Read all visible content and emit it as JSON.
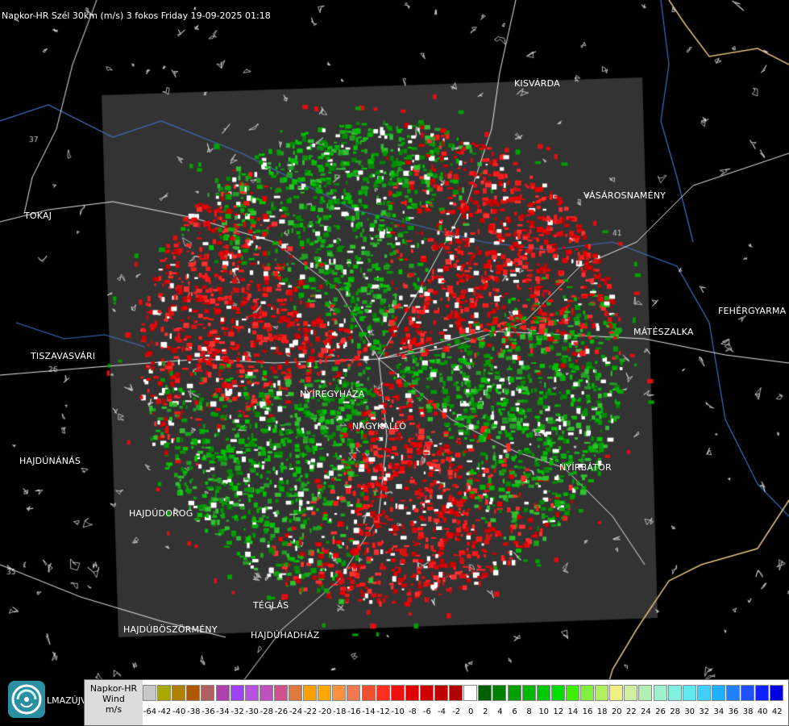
{
  "header": {
    "title": "Napkor-HR Szél 30km (m/s) 3 fokos Friday 19-09-2025 01:18"
  },
  "cities": [
    {
      "name": "KISVÁRDA"
    },
    {
      "name": "TOKAJ"
    },
    {
      "name": "VÁSÁROSNAMÉNY"
    },
    {
      "name": "FEHÉRGYARMA"
    },
    {
      "name": "MÁTÉSZALKA"
    },
    {
      "name": "TISZAVASVÁRI"
    },
    {
      "name": "NYÍREGYHÁZA"
    },
    {
      "name": "NAGYKALLÓ"
    },
    {
      "name": "HAJDÚNÁNÁS"
    },
    {
      "name": "NYÍRBÁTOR"
    },
    {
      "name": "HAJDÚDOROG"
    },
    {
      "name": "TÉGLÁS"
    },
    {
      "name": "HAJDÚBÖSZÖRMÉNY"
    },
    {
      "name": "HAJDÚHADHÁZ"
    },
    {
      "name": "LMAZÚJVÁR"
    }
  ],
  "road_numbers": [
    "37",
    "26",
    "35",
    "41"
  ],
  "legend": {
    "line1": "Napkor-HR",
    "line2": "Wind",
    "line3": "m/s",
    "colors": [
      "#c8c8c8",
      "#a8a800",
      "#b08000",
      "#b05800",
      "#b06060",
      "#b040b0",
      "#a040ff",
      "#b850e0",
      "#c050c0",
      "#d05090",
      "#e07840",
      "#ffa000",
      "#ffa800",
      "#ff9040",
      "#f07850",
      "#f05030",
      "#ff3020",
      "#f01010",
      "#e00000",
      "#d00000",
      "#c00000",
      "#b00000",
      "#ffffff",
      "#006000",
      "#008000",
      "#00a000",
      "#00b800",
      "#00c800",
      "#00e000",
      "#40f000",
      "#80f040",
      "#b0f060",
      "#f0f080",
      "#d0f0a0",
      "#b0f0b0",
      "#a0f0d0",
      "#80f0e0",
      "#60e8f0",
      "#40d0ff",
      "#20b0ff",
      "#2080ff",
      "#2050ff",
      "#1020ff",
      "#0000e0"
    ],
    "ticks": [
      "-64",
      "-42",
      "-40",
      "-38",
      "-36",
      "-34",
      "-32",
      "-30",
      "-28",
      "-26",
      "-24",
      "-22",
      "-20",
      "-18",
      "-16",
      "-14",
      "-12",
      "-10",
      "-8",
      "-6",
      "-4",
      "-2",
      "0",
      "2",
      "4",
      "6",
      "8",
      "10",
      "12",
      "14",
      "16",
      "18",
      "20",
      "22",
      "24",
      "26",
      "28",
      "30",
      "32",
      "34",
      "36",
      "38",
      "40",
      "42"
    ]
  },
  "logo": {
    "name": "napkor-logo"
  }
}
